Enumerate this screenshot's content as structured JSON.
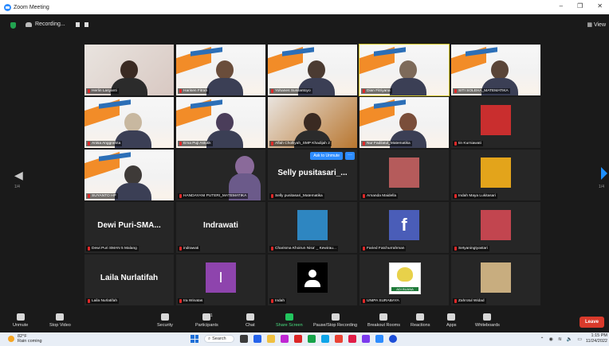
{
  "window": {
    "title": "Zoom Meeting"
  },
  "status": {
    "recording_label": "Recording...",
    "view_label": "View"
  },
  "nav": {
    "left_arrow": "◀",
    "right_arrow": "▶",
    "page_left": "1/4",
    "page_right": "1/4"
  },
  "ask_unmute": "Ask to Unmute",
  "more": "···",
  "tiles": [
    {
      "name": "Herlin Lasyanti",
      "kind": "webcam",
      "color": "#d8c8c2"
    },
    {
      "name": "Harisen Fitrah",
      "kind": "slide",
      "color": "#6a4d3b"
    },
    {
      "name": "Yohanes Susilantoyo",
      "kind": "slide",
      "color": "#4b3b32"
    },
    {
      "name": "Dian Fitriyana",
      "kind": "slide",
      "color": "#7d6a5a",
      "active": true
    },
    {
      "name": "SITI SOLEHA_MATEMATIKA",
      "kind": "slide",
      "color": "#5a4538"
    },
    {
      "name": "Anisa Anggrahita",
      "kind": "slide",
      "color": "#c8b8a0"
    },
    {
      "name": "Ema Puji Astutik",
      "kind": "slide",
      "color": "#4a3d5a"
    },
    {
      "name": "Aflah Cholliyah_SMP Khadijah 2",
      "kind": "webcam",
      "color": "#b8762f"
    },
    {
      "name": "Nur Fadilatul_Matematika",
      "kind": "slide",
      "color": "#7a4e3a"
    },
    {
      "name": "Iin Kurniawati",
      "kind": "avatar",
      "color": "#c92e2e"
    },
    {
      "name": "SUYANTO HP",
      "kind": "slide",
      "color": "#3e3a38"
    },
    {
      "name": "HANDAYANI PUTERI_MATEMATIKA",
      "kind": "orientasi",
      "color": "#6b5a8a"
    },
    {
      "name": "Selly pusitasari_Matematika",
      "kind": "text",
      "big": "Selly pusitasari_..."
    },
    {
      "name": "Amanda Maidella",
      "kind": "avatar",
      "color": "#b55b5b"
    },
    {
      "name": "Indah Maya Lukitasari",
      "kind": "avatar",
      "color": "#e3a41b"
    },
    {
      "name": "Dewi Puri SMAN 5 Malang",
      "kind": "text",
      "big": "Dewi Puri-SMA..."
    },
    {
      "name": "indrawati",
      "kind": "text",
      "big": "Indrawati"
    },
    {
      "name": "Charisma Khoirun Nisa' _ Kewirau...",
      "kind": "avatar",
      "color": "#2e86c1"
    },
    {
      "name": "Faried Fatchurrahman",
      "kind": "facebook",
      "color": "#4a5db8"
    },
    {
      "name": "Setyaningtyastari",
      "kind": "avatar",
      "color": "#c2454f"
    },
    {
      "name": "Laila Nurlatifah",
      "kind": "text",
      "big": "Laila Nurlatifah"
    },
    {
      "name": "Ira Winatas",
      "kind": "letter",
      "letter": "I",
      "color": "#8e44ad"
    },
    {
      "name": "Indah",
      "kind": "silhouette",
      "color": "#000000"
    },
    {
      "name": "UNIPA SURABAYA",
      "kind": "logo",
      "color": "#e8d14a",
      "logo_text": "ADI BUANA"
    },
    {
      "name": "Zahrotul Widad",
      "kind": "avatar",
      "color": "#c8ad7f"
    }
  ],
  "toolbar": {
    "unmute": "Unmute",
    "stop_video": "Stop Video",
    "security": "Security",
    "participants": "Participants",
    "participants_count": "31",
    "chat": "Chat",
    "share_screen": "Share Screen",
    "pause_recording": "Pause/Stop Recording",
    "breakout": "Breakout Rooms",
    "reactions": "Reactions",
    "apps": "Apps",
    "whiteboards": "Whiteboards",
    "leave": "Leave"
  },
  "taskbar": {
    "temperature": "82°F",
    "weather_desc": "Rain coming",
    "search_label": "Search",
    "time": "1:15 PM",
    "date": "11/24/2022"
  }
}
